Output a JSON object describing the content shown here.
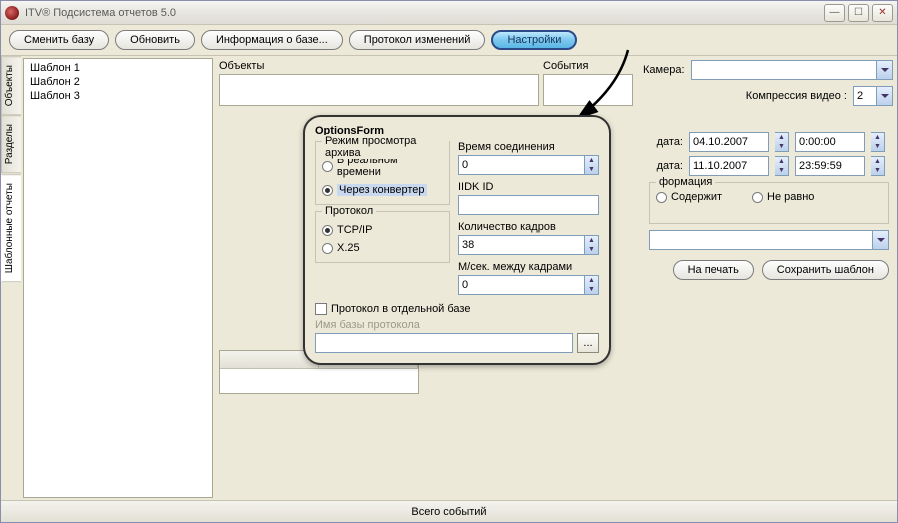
{
  "window": {
    "title": "ITV® Подсистема отчетов 5.0"
  },
  "toolbar": {
    "change_base": "Сменить базу",
    "refresh": "Обновить",
    "db_info": "Информация о базе...",
    "protocol": "Протокол изменений",
    "settings": "Настройки"
  },
  "side_tabs": {
    "objects": "Объекты",
    "sections": "Разделы",
    "templates": "Шаблонные отчеты"
  },
  "templates": {
    "items": [
      "Шаблон 1",
      "Шаблон 2",
      "Шаблон 3"
    ]
  },
  "labels": {
    "objects": "Объекты",
    "events": "События",
    "camera": "Камера:",
    "compression": "Компрессия видео :",
    "date": "дата:",
    "info": "формация",
    "contains": "Содержит",
    "not_equal": "Не равно",
    "print": "На печать",
    "save_template": "Сохранить шаблон"
  },
  "filters": {
    "compression_value": "2",
    "start_date": "04.10.2007",
    "start_time": "0:00:00",
    "end_date": "11.10.2007",
    "end_time": "23:59:59"
  },
  "dialog": {
    "title": "OptionsForm",
    "archive_mode_legend": "Режим просмотра архива",
    "realtime": "В реальном времени",
    "via_converter": "Через конвертер",
    "protocol_legend": "Протокол",
    "tcpip": "TCP/IP",
    "x25": "X.25",
    "conn_time": "Время соединения",
    "conn_time_value": "0",
    "iidk_id": "IIDK ID",
    "iidk_value": "",
    "frame_count": "Количество кадров",
    "frame_count_value": "38",
    "frame_interval": "М/сек. между кадрами",
    "frame_interval_value": "0",
    "separate_db": "Протокол в отдельной базе",
    "db_name_label": "Имя базы протокола",
    "db_name_value": "",
    "browse": "..."
  },
  "status": {
    "total": "Всего событий"
  }
}
